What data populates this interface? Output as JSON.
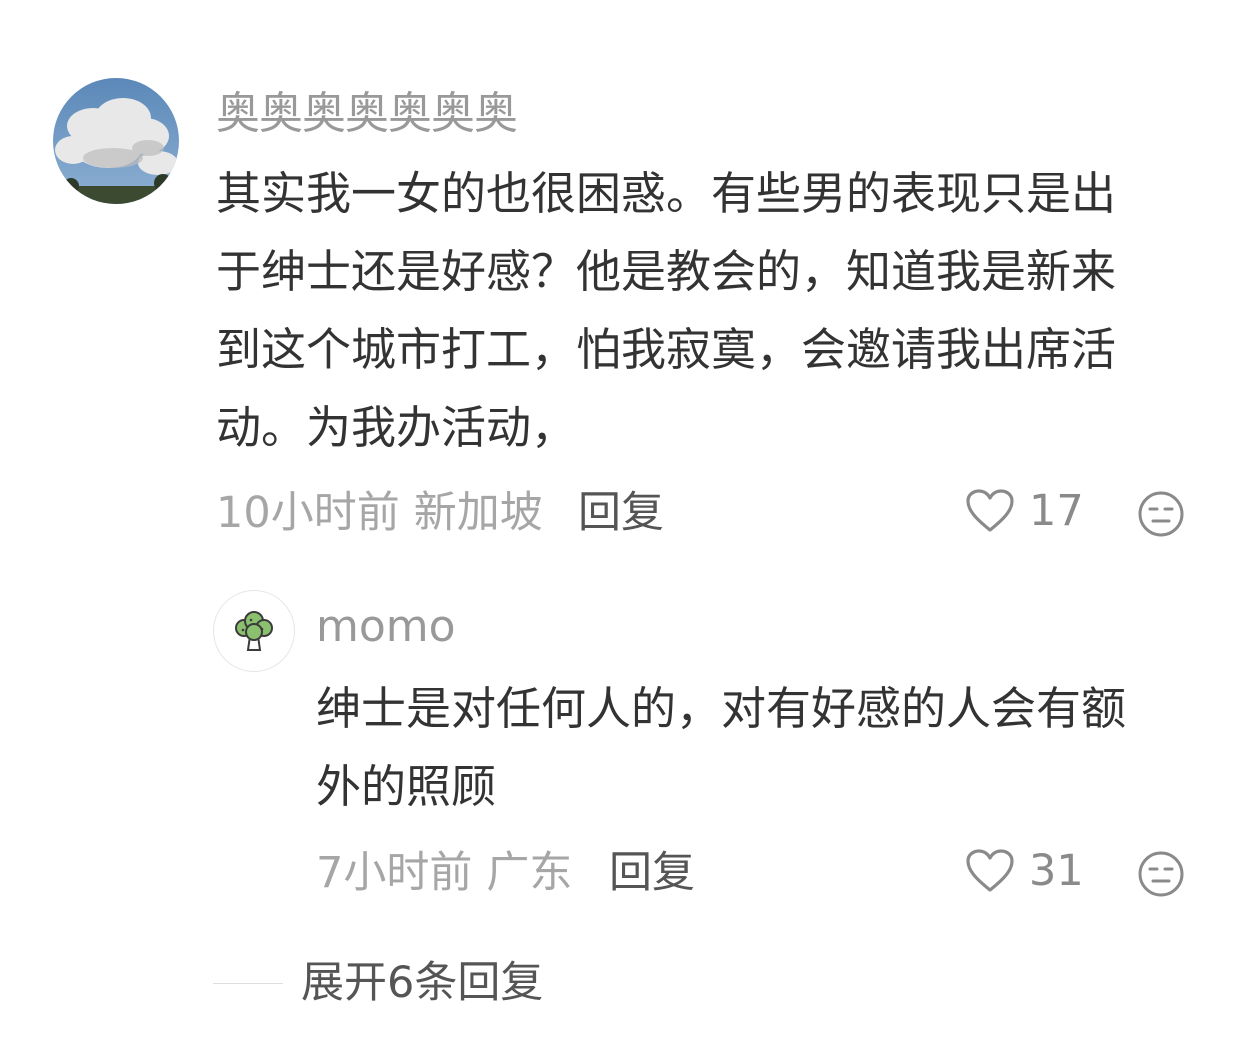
{
  "comment": {
    "author": "奥奥奥奥奥奥奥",
    "avatar_icon": "cloud-sky-avatar",
    "text_lines": [
      "其实我一女的也很困惑。有些男的表现只是出",
      "于绅士还是好感？他是教会的，知道我是新来",
      "到这个城市打工，怕我寂寞，会邀请我出席活",
      "动。为我办活动，"
    ],
    "time": "10小时前",
    "location": "新加坡",
    "reply_label": "回复",
    "likes": "17",
    "like_icon": "heart-icon",
    "dislike_icon": "meh-face-icon"
  },
  "reply": {
    "author": "momo",
    "avatar_icon": "broccoli-avatar",
    "text_lines": [
      "绅士是对任何人的，对有好感的人会有额",
      "外的照顾"
    ],
    "time": "7小时前",
    "location": "广东",
    "reply_label": "回复",
    "likes": "31",
    "like_icon": "heart-icon",
    "dislike_icon": "meh-face-icon"
  },
  "expand_replies": {
    "label": "展开6条回复"
  },
  "colors": {
    "text_primary": "#333333",
    "text_secondary": "#999999",
    "icon_gray": "#8a8a8a"
  }
}
